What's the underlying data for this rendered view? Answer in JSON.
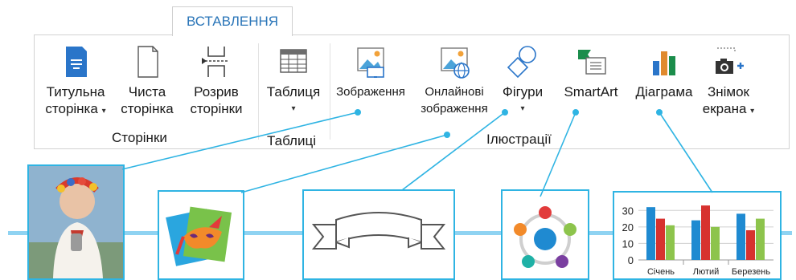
{
  "ribbon": {
    "active_tab": "ВСТАВЛЕННЯ",
    "buttons": {
      "cover_page": {
        "line1": "Титульна",
        "line2": "сторінка"
      },
      "blank_page": {
        "line1": "Чиста",
        "line2": "сторінка"
      },
      "page_break": {
        "line1": "Розрив",
        "line2": "сторінки"
      },
      "table": {
        "line1": "Таблиця"
      },
      "pictures": {
        "line1": "Зображення"
      },
      "online_pictures": {
        "line1": "Онлайнові",
        "line2": "зображення"
      },
      "shapes": {
        "line1": "Фігури"
      },
      "smartart": {
        "line1": "SmartArt"
      },
      "chart": {
        "line1": "Діаграма"
      },
      "screenshot": {
        "line1": "Знімок",
        "line2": "екрана"
      }
    },
    "groups": {
      "pages": "Сторінки",
      "tables": "Таблиці",
      "illustrations": "Ілюстрації"
    },
    "dropdown_arrow": "▾"
  },
  "chart_data": {
    "type": "bar",
    "categories": [
      "Січень",
      "Лютий",
      "Березень"
    ],
    "series": [
      {
        "values": [
          32,
          24,
          28
        ]
      },
      {
        "values": [
          25,
          33,
          18
        ]
      },
      {
        "values": [
          21,
          20,
          25
        ]
      }
    ],
    "ylim": [
      0,
      35
    ],
    "yticks": [
      "0",
      "10",
      "20",
      "30"
    ],
    "colors": [
      "#1f8ad1",
      "#d7322f",
      "#8dc44c"
    ]
  },
  "colors": {
    "accent": "#2fb4e3",
    "tab_text": "#2a75b8",
    "timeline": "#8fd3f2"
  }
}
